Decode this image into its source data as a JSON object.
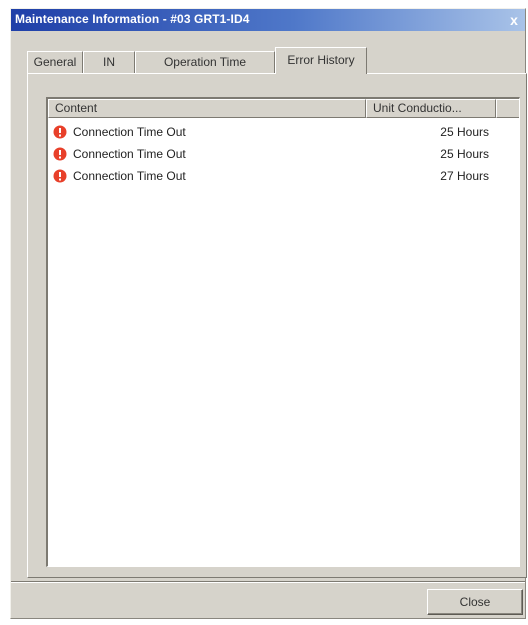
{
  "window": {
    "title": "Maintenance Information - #03 GRT1-ID4",
    "close_glyph": "x"
  },
  "tabs": [
    {
      "label": "General",
      "active": false
    },
    {
      "label": "IN",
      "active": false
    },
    {
      "label": "Operation Time",
      "active": false
    },
    {
      "label": "Error History",
      "active": true
    }
  ],
  "error_list": {
    "columns": [
      "Content",
      "Unit Conductio..."
    ],
    "rows": [
      {
        "icon": "error-icon",
        "content": "Connection Time Out",
        "value": "25 Hours"
      },
      {
        "icon": "error-icon",
        "content": "Connection Time Out",
        "value": "25 Hours"
      },
      {
        "icon": "error-icon",
        "content": "Connection Time Out",
        "value": "27 Hours"
      }
    ]
  },
  "footer": {
    "close_label": "Close"
  },
  "colors": {
    "error_icon": "#e8402a",
    "titlebar_start": "#1f3fa8",
    "titlebar_end": "#a9c3e8",
    "dialog_face": "#d6d3cb"
  }
}
